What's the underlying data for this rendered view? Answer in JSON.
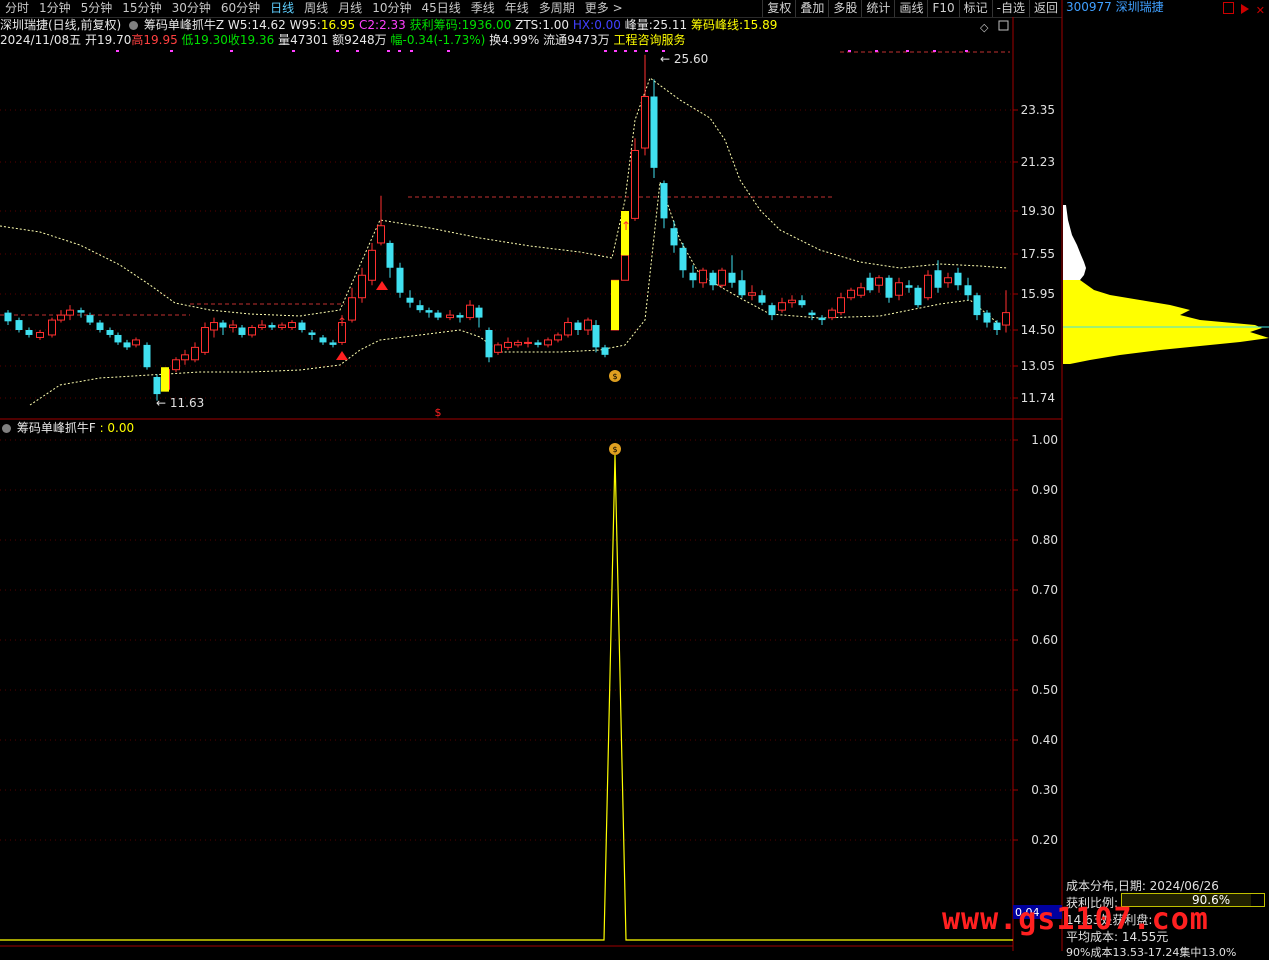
{
  "toolbar": {
    "tabs": [
      {
        "label": "分时",
        "active": false
      },
      {
        "label": "1分钟",
        "active": false
      },
      {
        "label": "5分钟",
        "active": false
      },
      {
        "label": "15分钟",
        "active": false
      },
      {
        "label": "30分钟",
        "active": false
      },
      {
        "label": "60分钟",
        "active": false
      },
      {
        "label": "日线",
        "active": true
      },
      {
        "label": "周线",
        "active": false
      },
      {
        "label": "月线",
        "active": false
      },
      {
        "label": "10分钟",
        "active": false
      },
      {
        "label": "45日线",
        "active": false
      },
      {
        "label": "季线",
        "active": false
      },
      {
        "label": "年线",
        "active": false
      },
      {
        "label": "多周期",
        "active": false
      },
      {
        "label": "更多 >",
        "active": false
      }
    ],
    "buttons": [
      "复权",
      "叠加",
      "多股",
      "统计",
      "画线",
      "F10",
      "标记",
      "-自选",
      "返回"
    ]
  },
  "stock": {
    "code_name": "300977 深圳瑞捷",
    "title": "深圳瑞捷(日线,前复权)",
    "indicator_name": "筹码单峰抓牛Z",
    "w5_label": "W5:",
    "w5": "14.62",
    "w95_label": "W95:",
    "w95": "16.95",
    "c2_label": "C2:",
    "c2": "2.33",
    "profit_label": "获利筹码:",
    "profit": "1936.00",
    "zts_label": "ZTS:",
    "zts": "1.00",
    "hx_label": "HX:",
    "hx": "0.00",
    "peak_label": "峰量:",
    "peak": "25.11",
    "peakline_label": "筹码峰线:",
    "peakline": "15.89"
  },
  "quote": {
    "date": "2024/11/08五",
    "open": "开19.70",
    "high": "高19.95",
    "low": "低19.30",
    "close": "收19.36",
    "volume": "量47301",
    "amount": "额9248万",
    "change": "幅-0.34(-1.73%)",
    "turnover": "换4.99%",
    "float": "流通9473万",
    "sector": "工程咨询服务"
  },
  "main_axis": {
    "ticks": [
      "23.35",
      "21.23",
      "19.30",
      "17.55",
      "15.95",
      "14.50",
      "13.05",
      "11.74"
    ],
    "max_label": "25.60",
    "min_label": "11.63",
    "colors": {
      "up": "#ff3030",
      "down": "#40e0f0",
      "signal": "#ffff00",
      "line": "#ffffc0"
    }
  },
  "sub_panel": {
    "title": "筹码单峰抓牛F",
    "value": ": 0.00",
    "ticks": [
      "1.00",
      "0.90",
      "0.80",
      "0.70",
      "0.60",
      "0.50",
      "0.40",
      "0.30",
      "0.20"
    ],
    "current": "0.04"
  },
  "cost_distribution": {
    "title": "成本分布,日期: 2024/06/26",
    "profit_label": "获利比例:",
    "profit_value": "90.6%",
    "profit_price_label": "14.63处获利盘:",
    "avg_label": "平均成本:",
    "avg_value": "14.55元",
    "range_text": "90%成本13.53-17.24集中13.0%"
  },
  "watermark": "www.gs1107.com"
}
